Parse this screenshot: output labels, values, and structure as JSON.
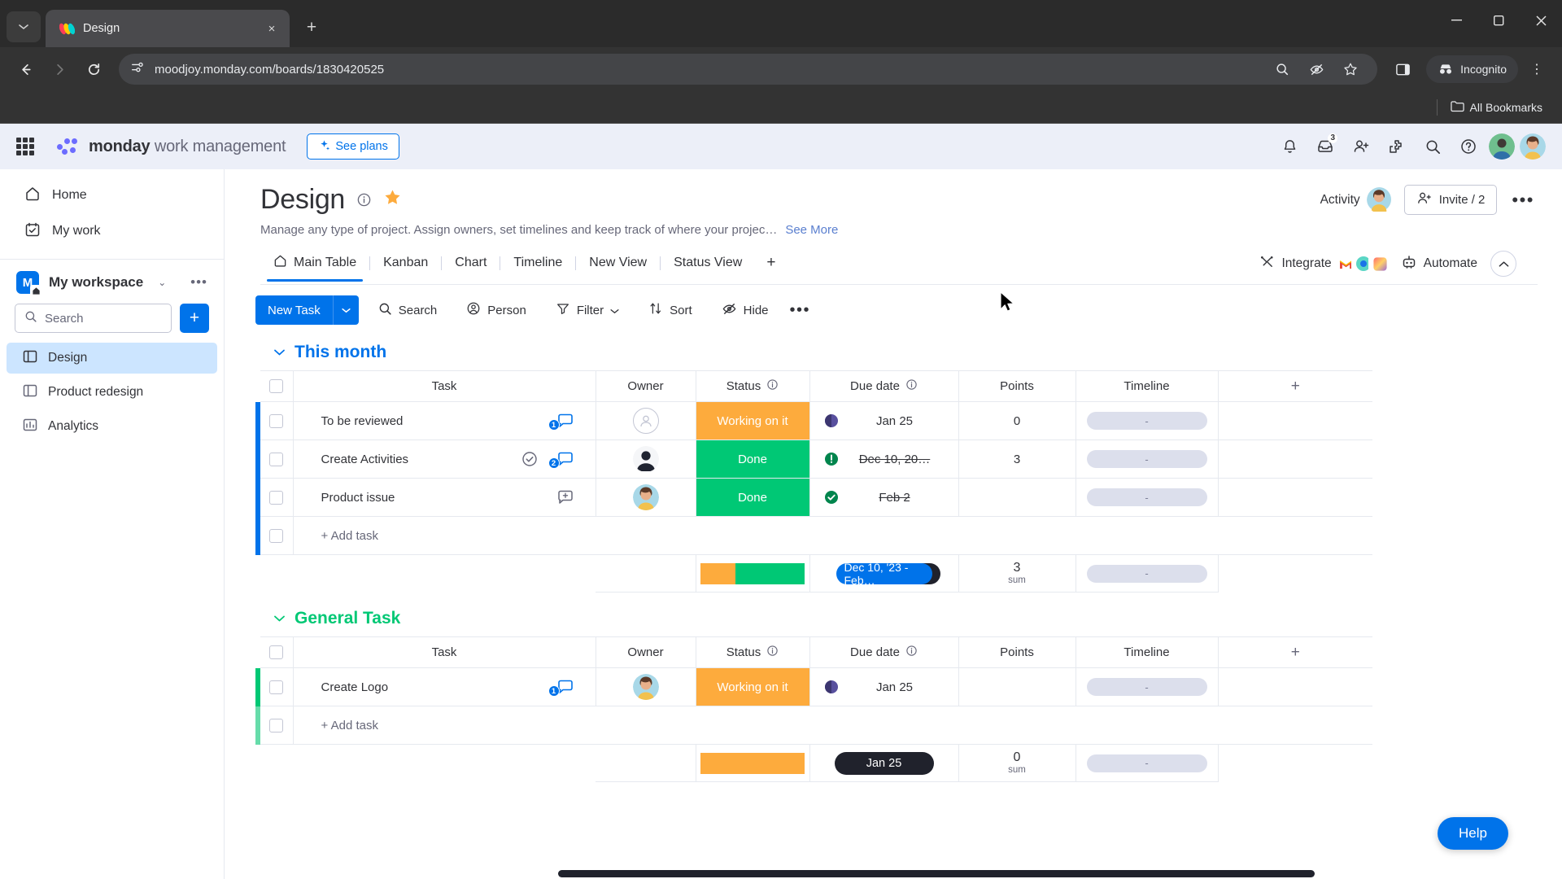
{
  "browser": {
    "tab": {
      "title": "Design",
      "favicon": "monday-logo-icon",
      "close_label": "×"
    },
    "new_tab_label": "+",
    "tab_list_label": "⌄",
    "window": {
      "minimize": "–",
      "maximize": "□",
      "close": "✕"
    },
    "nav": {
      "back": "←",
      "forward": "→",
      "reload": "↻"
    },
    "url": "moodjoy.monday.com/boards/1830420525",
    "omnibox_icons": [
      "zoom-icon",
      "hidden-eye-icon",
      "star-icon"
    ],
    "split_icon": "split-view-icon",
    "incognito_label": "Incognito",
    "profile_menu": "⋮",
    "bookmarks": {
      "label": "All Bookmarks",
      "icon": "folder-icon"
    }
  },
  "topbar": {
    "apps_icon": "grid-apps-icon",
    "brand_bold": "monday",
    "brand_light": " work management",
    "see_plans": "See plans",
    "icons": [
      {
        "name": "notifications-bell-icon"
      },
      {
        "name": "inbox-icon",
        "badge": "3"
      },
      {
        "name": "invite-members-icon"
      },
      {
        "name": "apps-marketplace-icon"
      },
      {
        "name": "search-icon"
      },
      {
        "name": "help-icon"
      }
    ]
  },
  "sidebar": {
    "links": [
      {
        "label": "Home",
        "icon": "home-icon"
      },
      {
        "label": "My work",
        "icon": "my-work-calendar-icon"
      }
    ],
    "workspace": {
      "initial": "M",
      "name": "My workspace",
      "caret": "⌄",
      "dots": "•••"
    },
    "search_placeholder": "Search",
    "add_label": "+",
    "boards": [
      {
        "label": "Design",
        "icon": "board-icon",
        "active": true
      },
      {
        "label": "Product redesign",
        "icon": "board-icon",
        "active": false
      },
      {
        "label": "Analytics",
        "icon": "dashboard-chart-icon",
        "active": false
      }
    ]
  },
  "board": {
    "title": "Design",
    "info_icon": "info-icon",
    "star_icon": "star-favorite-icon",
    "description": "Manage any type of project. Assign owners, set timelines and keep track of where your projec…",
    "see_more": "See More",
    "activity_label": "Activity",
    "invite_label": "Invite / 2",
    "more_label": "•••",
    "tabs": [
      {
        "label": "Main Table",
        "icon": "home-icon",
        "active": true
      },
      {
        "label": "Kanban",
        "active": false
      },
      {
        "label": "Chart",
        "active": false
      },
      {
        "label": "Timeline",
        "active": false
      },
      {
        "label": "New View",
        "active": false
      },
      {
        "label": "Status View",
        "active": false
      }
    ],
    "add_tab": "+",
    "integrate_label": "Integrate",
    "automate_label": "Automate",
    "collapse_icon": "chevron-up-icon"
  },
  "actions": {
    "new_task": "New Task",
    "new_task_caret": "⌄",
    "buttons": [
      {
        "label": "Search",
        "icon": "search-icon"
      },
      {
        "label": "Person",
        "icon": "person-icon"
      },
      {
        "label": "Filter",
        "icon": "filter-icon",
        "caret": "⌄"
      },
      {
        "label": "Sort",
        "icon": "sort-icon"
      },
      {
        "label": "Hide",
        "icon": "hide-eye-icon"
      }
    ],
    "more": "•••"
  },
  "table": {
    "columns": [
      "Task",
      "Owner",
      "Status",
      "Due date",
      "Points",
      "Timeline"
    ],
    "add_column": "+",
    "add_task_label": "+ Add task",
    "timeline_placeholder": "-",
    "sum_label": "sum"
  },
  "groups": [
    {
      "name": "This month",
      "color": "#0073ea",
      "caret": "⌄",
      "rows": [
        {
          "task": "To be reviewed",
          "conversation": "1",
          "owner": "empty",
          "status": "Working on it",
          "status_color": "#fdab3d",
          "due_icon": "half-moon-icon",
          "due": "Jan 25",
          "due_strike": false,
          "points": "0",
          "timeline": "-"
        },
        {
          "task": "Create Activities",
          "task_check": true,
          "conversation": "2",
          "owner": "dark-person-avatar",
          "status": "Done",
          "status_color": "#00c875",
          "due_icon": "alert-exclamation-icon",
          "due": "Dec 10, 20…",
          "due_strike": true,
          "points": "3",
          "timeline": "-"
        },
        {
          "task": "Product issue",
          "conversation": "add",
          "owner": "photo-avatar",
          "status": "Done",
          "status_color": "#00c875",
          "due_icon": "check-circle-icon",
          "due": "Feb 2",
          "due_strike": true,
          "points": "",
          "timeline": "-"
        }
      ],
      "summary": {
        "status_segments": [
          {
            "color": "#fdab3d",
            "pct": 33.3
          },
          {
            "color": "#00c875",
            "pct": 66.7
          }
        ],
        "date_range": "Dec 10, '23 - Feb…",
        "points": "3",
        "points_label": "sum",
        "timeline": "-"
      }
    },
    {
      "name": "General Task",
      "color": "#00c875",
      "caret": "⌄",
      "rows": [
        {
          "task": "Create Logo",
          "conversation": "1",
          "owner": "photo-avatar",
          "status": "Working on it",
          "status_color": "#fdab3d",
          "due_icon": "half-moon-icon",
          "due": "Jan 25",
          "due_strike": false,
          "points": "",
          "timeline": "-"
        }
      ],
      "summary": {
        "status_segments": [
          {
            "color": "#fdab3d",
            "pct": 100
          }
        ],
        "date_range": "Jan 25",
        "points": "0",
        "points_label": "sum",
        "timeline": "-"
      }
    }
  ],
  "help": {
    "label": "Help"
  }
}
